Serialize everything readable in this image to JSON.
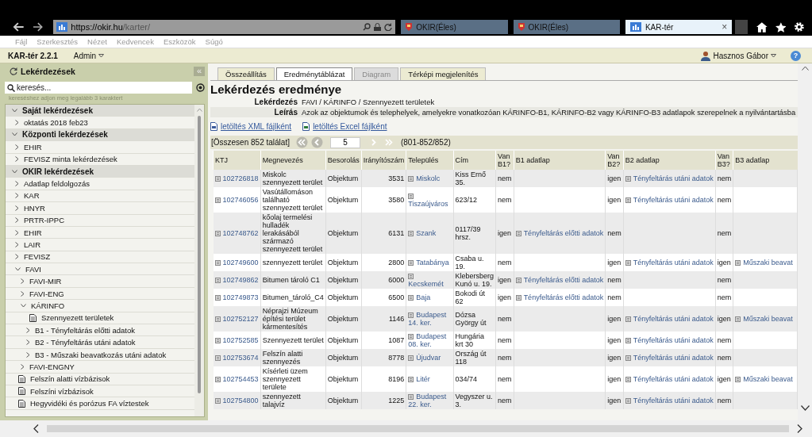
{
  "browser": {
    "address_host": "https://okir.hu",
    "address_path": "/karter/",
    "tabs": [
      {
        "label": "OKIR(Éles)",
        "selected": false
      },
      {
        "label": "OKIR(Éles)",
        "selected": false
      },
      {
        "label": "KAR-tér",
        "selected": true,
        "close": "×"
      }
    ]
  },
  "menu": [
    "Fájl",
    "Szerkesztés",
    "Nézet",
    "Kedvencek",
    "Eszközök",
    "Súgó"
  ],
  "app": {
    "title": "KAR-tér 2.2.1",
    "admin": "Admin",
    "user": "Hasznos Gábor",
    "help": "?"
  },
  "sidebar": {
    "title": "Lekérdezések",
    "collapse": "«",
    "search": {
      "placeholder": "keresés..."
    },
    "hint": "kereséshez adjon meg legalább 3 karaktert",
    "tree": [
      {
        "label": "Saját lekérdezések",
        "kind": "section",
        "expanded": true,
        "children": [
          {
            "label": "oktatás 2018 feb23",
            "kind": "folder",
            "expanded": false
          }
        ]
      },
      {
        "label": "Központi lekérdezések",
        "kind": "section",
        "expanded": true,
        "children": [
          {
            "label": "EHIR",
            "kind": "folder",
            "expanded": false
          },
          {
            "label": "FEVISZ minta lekérdezések",
            "kind": "folder",
            "expanded": false
          }
        ]
      },
      {
        "label": "OKIR lekérdezések",
        "kind": "section",
        "expanded": true,
        "children": [
          {
            "label": "Adatlap feldolgozás",
            "kind": "folder",
            "expanded": false
          },
          {
            "label": "KAR",
            "kind": "folder",
            "expanded": false
          },
          {
            "label": "HNYR",
            "kind": "folder",
            "expanded": false
          },
          {
            "label": "PRTR-IPPC",
            "kind": "folder",
            "expanded": false
          },
          {
            "label": "EHIR",
            "kind": "folder",
            "expanded": false
          },
          {
            "label": "LAIR",
            "kind": "folder",
            "expanded": false
          },
          {
            "label": "FEVISZ",
            "kind": "folder",
            "expanded": false
          },
          {
            "label": "FAVI",
            "kind": "folder",
            "expanded": true,
            "children": [
              {
                "label": "FAVI-MIR",
                "kind": "folder",
                "expanded": false
              },
              {
                "label": "FAVI-ENG",
                "kind": "folder",
                "expanded": false
              },
              {
                "label": "KÁRINFO",
                "kind": "folder",
                "expanded": true,
                "children": [
                  {
                    "label": "Szennyezett területek",
                    "kind": "doc"
                  },
                  {
                    "label": "B1 - Tényfeltárás előtti adatok",
                    "kind": "folder",
                    "expanded": false
                  },
                  {
                    "label": "B2 - Tényfeltárás utáni adatok",
                    "kind": "folder",
                    "expanded": false
                  },
                  {
                    "label": "B3 - Műszaki beavatkozás utáni adatok",
                    "kind": "folder",
                    "expanded": false
                  }
                ]
              },
              {
                "label": "FAVI-ENGNY",
                "kind": "folder",
                "expanded": false
              }
            ]
          },
          {
            "label": "Felszín alatti vízbázisok",
            "kind": "doc"
          },
          {
            "label": "Felszíni vízbázisok",
            "kind": "doc"
          },
          {
            "label": "Hegyvidéki és porózus FA víztestek",
            "kind": "doc"
          }
        ]
      }
    ]
  },
  "tabs": [
    {
      "label": "Összeállítás",
      "selected": false,
      "disabled": false
    },
    {
      "label": "Eredménytáblázat",
      "selected": true,
      "disabled": false
    },
    {
      "label": "Diagram",
      "selected": false,
      "disabled": true
    },
    {
      "label": "Térképi megjelenítés",
      "selected": false,
      "disabled": false
    }
  ],
  "title": "Lekérdezés eredménye",
  "info": [
    {
      "label": "Lekérdezés",
      "value": "FAVI / KÁRINFO / Szennyezett területek"
    },
    {
      "label": "Leírás",
      "value": "Azok az objektumok és telephelyek, amelyekre vonatkozóan KÁRINFO-B1, KÁRINFO-B2 vagy KÁRINFO-B3 adatlapok szerepelnek a nyilvántartásba"
    }
  ],
  "downloads": [
    "letöltés XML fájlként",
    "letöltés Excel fájlként"
  ],
  "pager": {
    "total": "[Összesen 852 találat]",
    "page": "5",
    "range": "(801-852/852)",
    "buttons": [
      {
        "kind": "first",
        "disabled": false
      },
      {
        "kind": "prev",
        "disabled": false
      },
      {
        "kind": "next",
        "disabled": true
      },
      {
        "kind": "last",
        "disabled": true
      }
    ]
  },
  "table": {
    "columns": [
      "KTJ",
      "Megnevezés",
      "Besorolás",
      "Irányítószám",
      "Település",
      "Cím",
      "Van B1?",
      "B1 adatlap",
      "Van B2?",
      "B2 adatlap",
      "Van B3?",
      "B3 adatlap"
    ],
    "rows": [
      {
        "ktj": "102726818",
        "name": "Miskolc szennyezett terület",
        "class": "Objektum",
        "zip": "3531",
        "city": "Miskolc",
        "address": "Kiss Ernő 35.",
        "b1": "nem",
        "b2": "igen",
        "b2_link": "Tényfeltárás utáni adatok",
        "b3": "nem"
      },
      {
        "ktj": "102746056",
        "name": "Vasútállomáson található szennyezett terület",
        "class": "Objektum",
        "zip": "3580",
        "city": "Tiszaújváros",
        "address": "623/12",
        "b1": "nem",
        "b2": "igen",
        "b2_link": "Tényfeltárás utáni adatok",
        "b3": "nem"
      },
      {
        "ktj": "102748762",
        "name": "kőolaj termelési hulladék lerakásából származó szennyezett terület",
        "class": "Objektum",
        "zip": "6131",
        "city": "Szank",
        "address": "0117/39 hrsz.",
        "b1": "igen",
        "b1_link": "Tényfeltárás előtti adatok",
        "b2": "nem",
        "b3": "nem"
      },
      {
        "ktj": "102749600",
        "name": "szennyezett terület",
        "class": "Objektum",
        "zip": "2800",
        "city": "Tatabánya",
        "address": "Csaba u. 19.",
        "b1": "nem",
        "b2": "igen",
        "b2_link": "Tényfeltárás utáni adatok",
        "b3": "igen",
        "b3_link": "Műszaki beavat"
      },
      {
        "ktj": "102749862",
        "name": "Bitumen tároló C1",
        "class": "Objektum",
        "zip": "6000",
        "city": "Kecskemét",
        "address": "Klebersberg Kunó u. 19.",
        "b1": "igen",
        "b1_link": "Tényfeltárás előtti adatok",
        "b2": "nem",
        "b3": "nem"
      },
      {
        "ktj": "102749873",
        "name": "Bitumen_tároló_C4",
        "class": "Objektum",
        "zip": "6500",
        "city": "Baja",
        "address": "Bokodi út 62",
        "b1": "igen",
        "b1_link": "Tényfeltárás előtti adatok",
        "b2": "nem",
        "b3": "nem"
      },
      {
        "ktj": "102752127",
        "name": "Néprajzi Múzeum építési terület kármentesítés",
        "class": "Objektum",
        "zip": "1146",
        "city": "Budapest 14. ker.",
        "address": "Dózsa György út",
        "b1": "nem",
        "b2": "igen",
        "b2_link": "Tényfeltárás utáni adatok",
        "b3": "igen",
        "b3_link": "Műszaki beavat"
      },
      {
        "ktj": "102752585",
        "name": "Szennyezett terület",
        "class": "Objektum",
        "zip": "1087",
        "city": "Budapest 08. ker.",
        "address": "Hungária krt 30",
        "b1": "nem",
        "b2": "igen",
        "b2_link": "Tényfeltárás utáni adatok",
        "b3": "nem"
      },
      {
        "ktj": "102753674",
        "name": "Felszín alatti szennyezés",
        "class": "Objektum",
        "zip": "8778",
        "city": "Újudvar",
        "address": "Ország út 118",
        "b1": "nem",
        "b2": "igen",
        "b2_link": "Tényfeltárás utáni adatok",
        "b3": "nem"
      },
      {
        "ktj": "102754453",
        "name": "Kísérleti üzem szennyezett területe",
        "class": "Objektum",
        "zip": "8196",
        "city": "Litér",
        "address": "034/74",
        "b1": "nem",
        "b2": "igen",
        "b2_link": "Tényfeltárás utáni adatok",
        "b3": "igen",
        "b3_link": "Műszaki beavat"
      },
      {
        "ktj": "102754800",
        "name": "szennyezett talajvíz",
        "class": "Objektum",
        "zip": "1225",
        "city": "Budapest 22. ker.",
        "address": "Vegyszer u. 3.",
        "b1": "nem",
        "b2": "igen",
        "b2_link": "Tényfeltárás utáni adatok",
        "b3": "nem"
      }
    ]
  }
}
